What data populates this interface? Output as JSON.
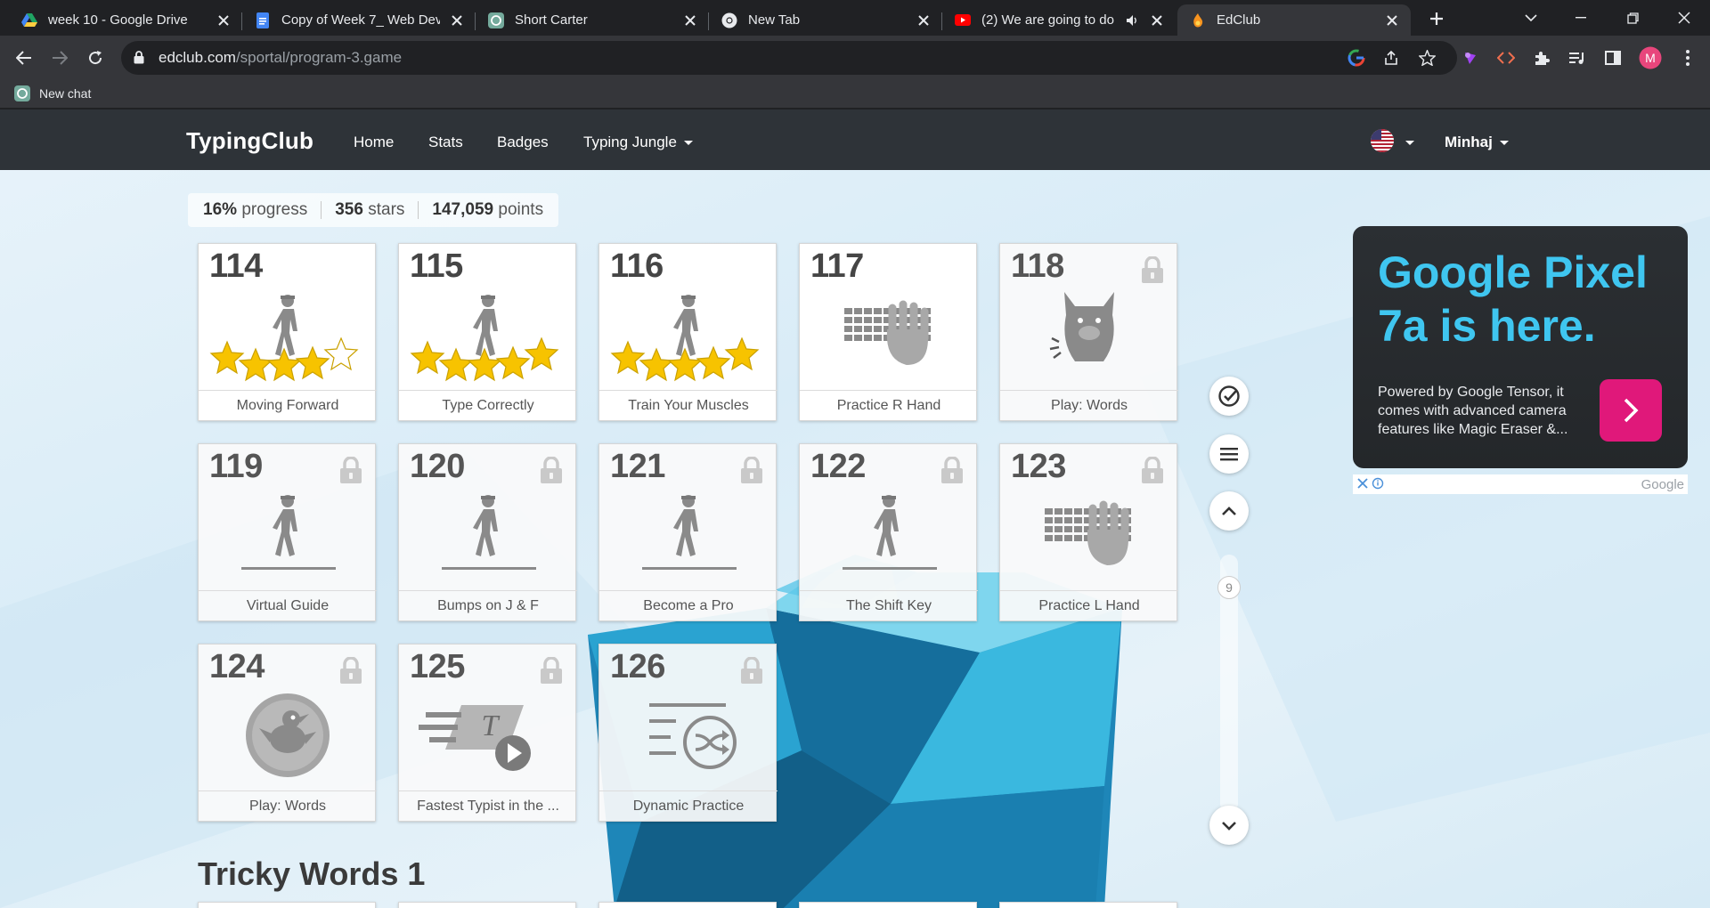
{
  "browser": {
    "tabs": [
      {
        "title": "week 10 - Google Drive",
        "icon": "google-drive-icon"
      },
      {
        "title": "Copy of Week 7_ Web Deve",
        "icon": "google-docs-icon"
      },
      {
        "title": "Short Carter",
        "icon": "chatgpt-icon"
      },
      {
        "title": "New Tab",
        "icon": "chrome-icon"
      },
      {
        "title": "(2) We are going to do",
        "icon": "youtube-icon"
      },
      {
        "title": "EdClub",
        "icon": "edclub-icon",
        "active": true
      }
    ],
    "url_host": "edclub.com",
    "url_path": "/sportal/program-3.game",
    "bookmark": "New chat",
    "profile_initial": "M"
  },
  "site": {
    "brand": "TypingClub",
    "nav": [
      "Home",
      "Stats",
      "Badges",
      "Typing Jungle"
    ],
    "user": "Minhaj"
  },
  "progress": {
    "percent": "16%",
    "percent_label": "progress",
    "stars": "356",
    "stars_label": "stars",
    "points": "147,059",
    "points_label": "points"
  },
  "lessons": [
    {
      "num": "114",
      "title": "Moving Forward",
      "art": "walker",
      "stars": 4,
      "locked": false
    },
    {
      "num": "115",
      "title": "Type Correctly",
      "art": "walker",
      "stars": 5,
      "locked": false
    },
    {
      "num": "116",
      "title": "Train Your Muscles",
      "art": "walker",
      "stars": 5,
      "locked": false
    },
    {
      "num": "117",
      "title": "Practice R Hand",
      "art": "keyboard-hand",
      "stars": 0,
      "locked": false
    },
    {
      "num": "118",
      "title": "Play: Words",
      "art": "creature",
      "stars": 0,
      "locked": true
    },
    {
      "num": "119",
      "title": "Virtual Guide",
      "art": "walker",
      "stars": 0,
      "locked": true
    },
    {
      "num": "120",
      "title": "Bumps on J & F",
      "art": "walker",
      "stars": 0,
      "locked": true
    },
    {
      "num": "121",
      "title": "Become a Pro",
      "art": "walker",
      "stars": 0,
      "locked": true
    },
    {
      "num": "122",
      "title": "The Shift Key",
      "art": "walker",
      "stars": 0,
      "locked": true
    },
    {
      "num": "123",
      "title": "Practice L Hand",
      "art": "keyboard-hand",
      "stars": 0,
      "locked": true
    },
    {
      "num": "124",
      "title": "Play: Words",
      "art": "bird-disc",
      "stars": 0,
      "locked": true
    },
    {
      "num": "125",
      "title": "Fastest Typist in the ...",
      "art": "speed-play",
      "stars": 0,
      "locked": true
    },
    {
      "num": "126",
      "title": "Dynamic Practice",
      "art": "shuffle-lines",
      "stars": 0,
      "locked": true
    }
  ],
  "scroll_indicator": "9",
  "section_title": "Tricky Words 1",
  "ad": {
    "title": "Google Pixel 7a is here.",
    "body": "Powered by Google Tensor, it comes with advanced camera features like Magic Eraser &...",
    "source": "Google"
  },
  "colors": {
    "nav_bg": "#2e3338",
    "ad_title": "#3fc6f0",
    "ad_cta": "#e0187a",
    "star": "#f7c300"
  }
}
